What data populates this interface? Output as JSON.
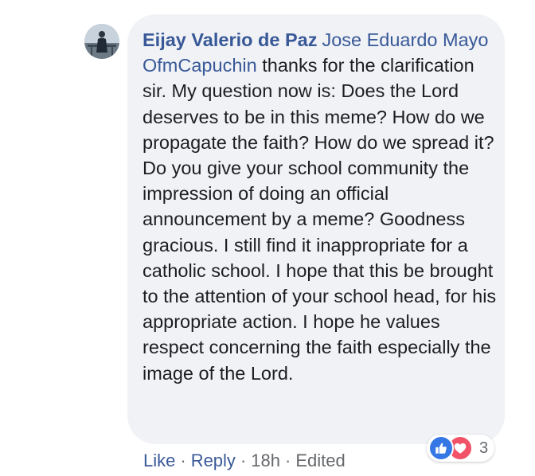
{
  "comment": {
    "author": "Eijay Valerio de Paz",
    "mention": "Jose Eduardo Mayo OfmCapuchin",
    "text": " thanks for the clarification sir. My question now is: Does the Lord deserves to be in this meme? How do we propagate the faith? How do we spread it? Do you give your school community the impression of doing an official announcement by a meme? Goodness gracious. I still find it inappropriate for a catholic school. I hope that this be brought to the attention of your school head, for his appropriate action. I hope he values respect concerning the faith especially the image of the Lord."
  },
  "actions": {
    "like": "Like",
    "reply": "Reply",
    "separator": "·",
    "time": "18h",
    "edited": "Edited"
  },
  "reactions": {
    "count": "3",
    "types": [
      "like-icon",
      "love-icon"
    ]
  },
  "colors": {
    "link": "#385898",
    "bubble": "#f0f2f5",
    "text": "#1c1e21",
    "meta": "#65676b",
    "like": "#3578e5",
    "love": "#f25268"
  }
}
